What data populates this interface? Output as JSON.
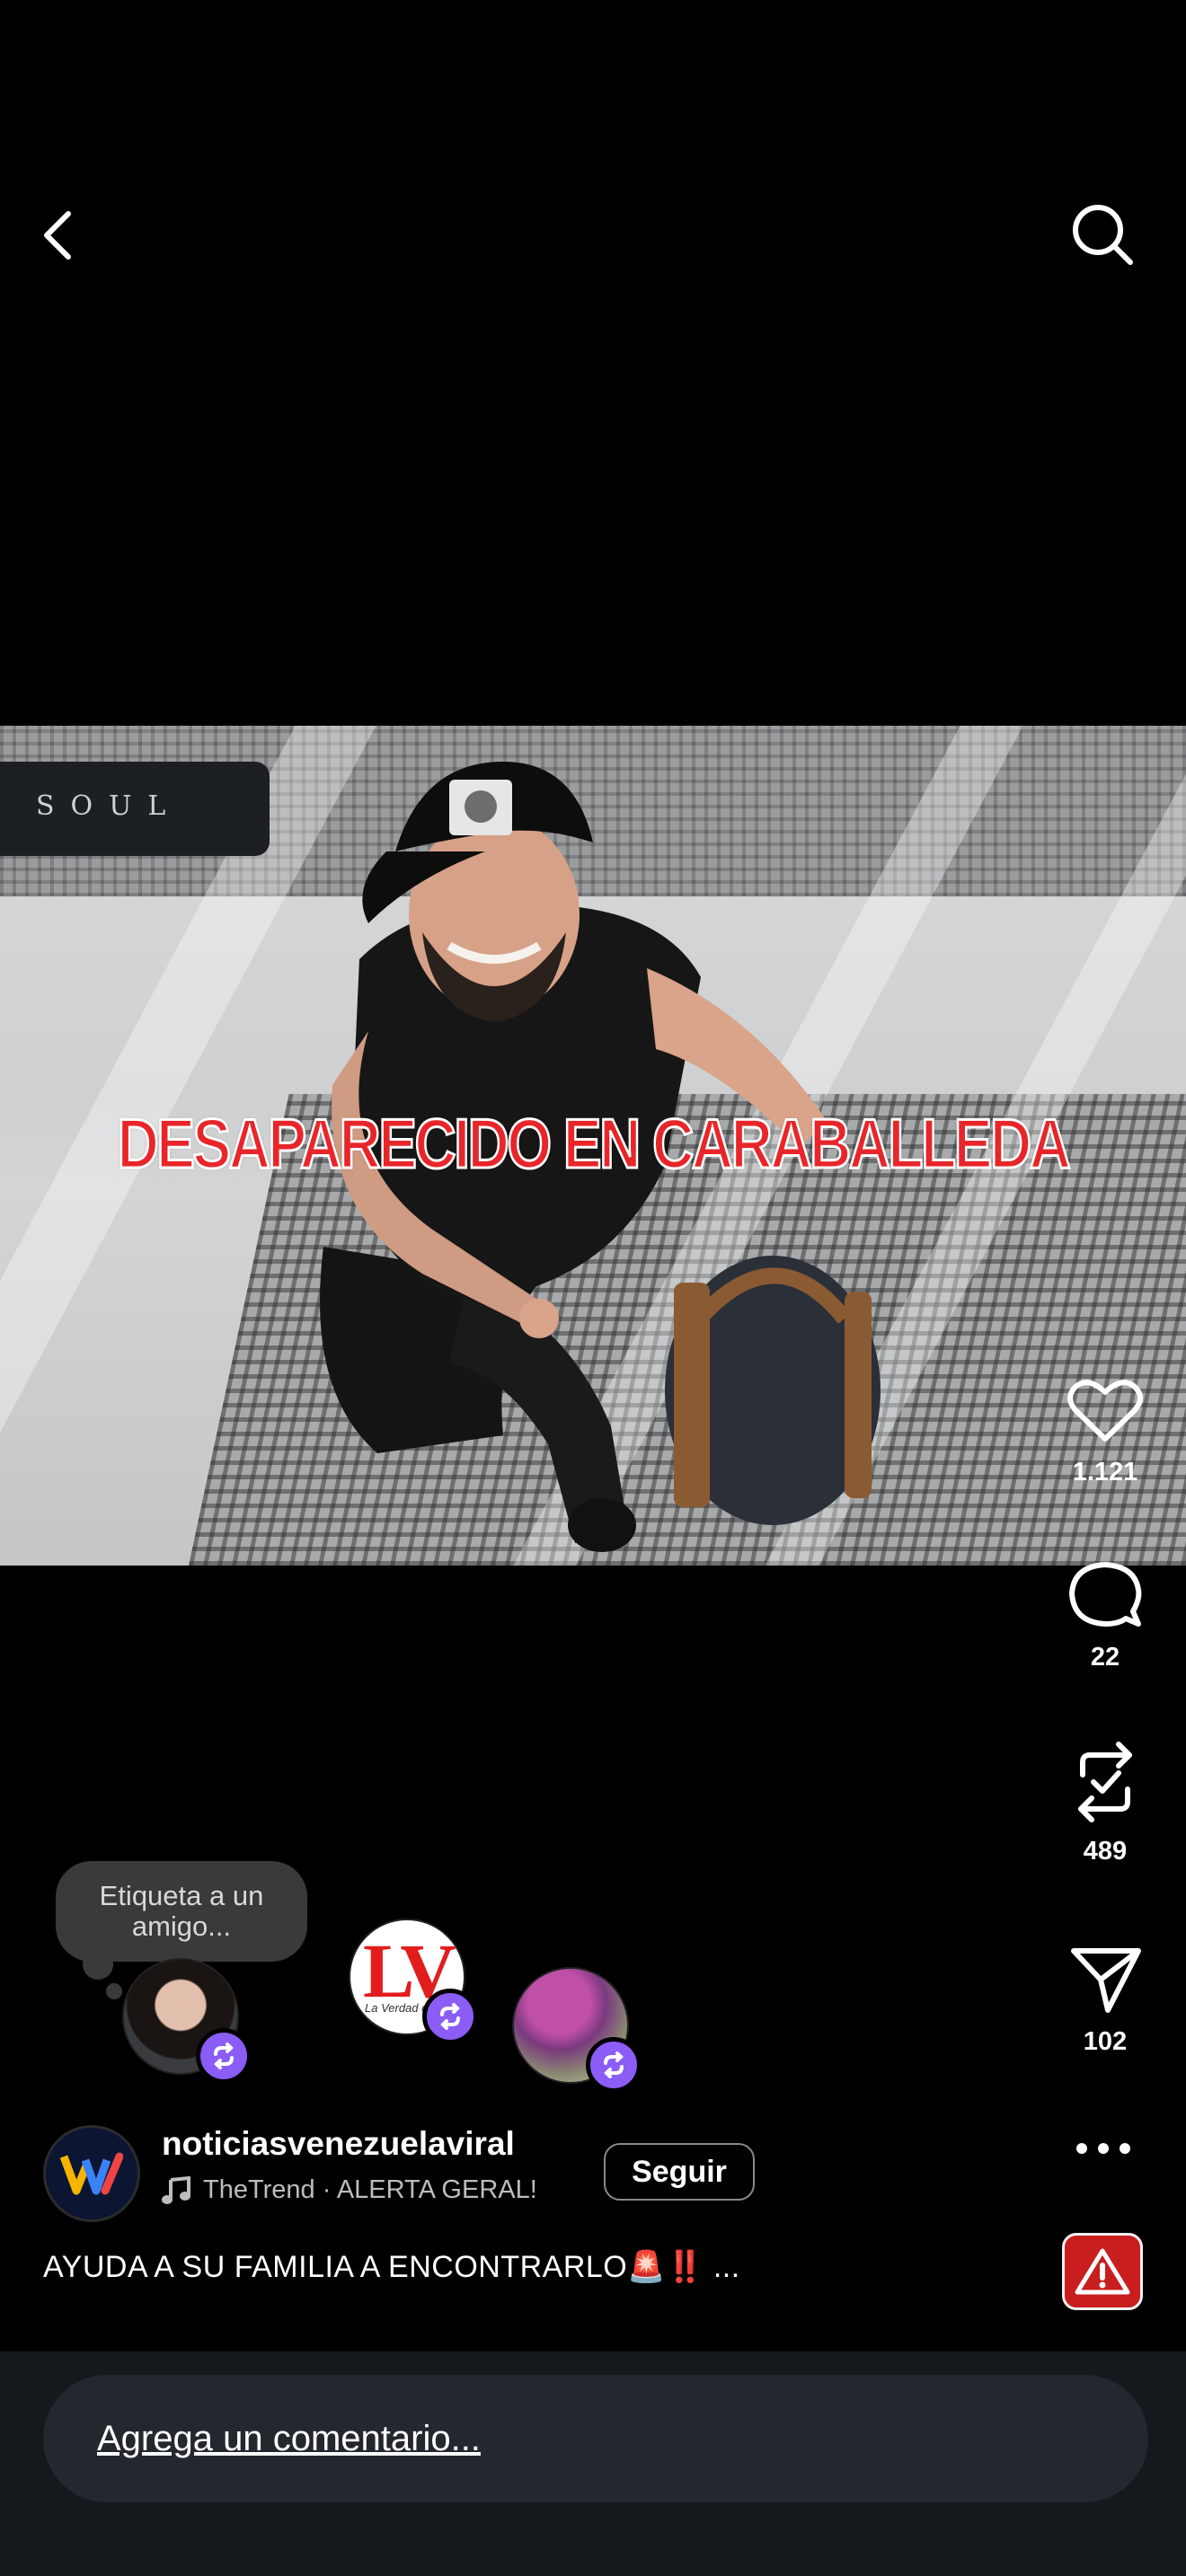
{
  "header": {
    "back_icon": "chevron-left-icon",
    "search_icon": "search-icon"
  },
  "video": {
    "overlay_text": "DESAPARECIDO EN CARABALLEDA",
    "sign_text": "SOUL"
  },
  "actions": {
    "likes": "1.121",
    "comments": "22",
    "reposts": "489",
    "shares": "102"
  },
  "reposters": {
    "tooltip": "Etiqueta a un amigo...",
    "badge_icon": "repost-icon",
    "lv_logo_text": "LV",
    "lv_logo_sub": "La Verdad de"
  },
  "post": {
    "username": "noticiasvenezuelaviral",
    "music": "TheTrend · ALERTA GERAL!",
    "follow_label": "Seguir",
    "caption": "AYUDA A SU FAMILIA A ENCONTRARLO🚨‼️ ..."
  },
  "comment_bar": {
    "placeholder": "Agrega un comentario..."
  },
  "colors": {
    "background": "#000000",
    "accent_purple": "#8b5cf6",
    "overlay_red": "#e8262a",
    "alert_red": "#c81e1e"
  }
}
